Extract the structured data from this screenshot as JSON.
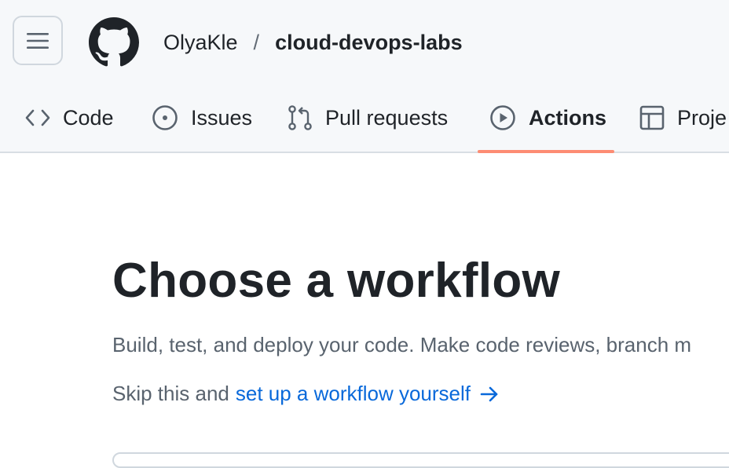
{
  "header": {
    "owner": "OlyaKle",
    "separator": "/",
    "repo": "cloud-devops-labs",
    "menu_icon": "hamburger-icon",
    "logo_icon": "github-mark-icon"
  },
  "tabs": [
    {
      "label": "Code",
      "icon": "code-icon",
      "selected": false
    },
    {
      "label": "Issues",
      "icon": "issue-opened-icon",
      "selected": false
    },
    {
      "label": "Pull requests",
      "icon": "git-pull-request-icon",
      "selected": false
    },
    {
      "label": "Actions",
      "icon": "play-icon",
      "selected": true
    },
    {
      "label": "Proje",
      "icon": "table-icon",
      "selected": false
    }
  ],
  "main": {
    "title": "Choose a workflow",
    "description": "Build, test, and deploy your code. Make code reviews, branch m",
    "skip_prefix": "Skip this and",
    "skip_link": "set up a workflow yourself",
    "skip_arrow_icon": "arrow-right-icon"
  },
  "colors": {
    "header_bg": "#f6f8fa",
    "text": "#1f2328",
    "muted": "#59636e",
    "link": "#0969da",
    "selected_underline": "#fd8c73",
    "border": "#d0d7de"
  }
}
